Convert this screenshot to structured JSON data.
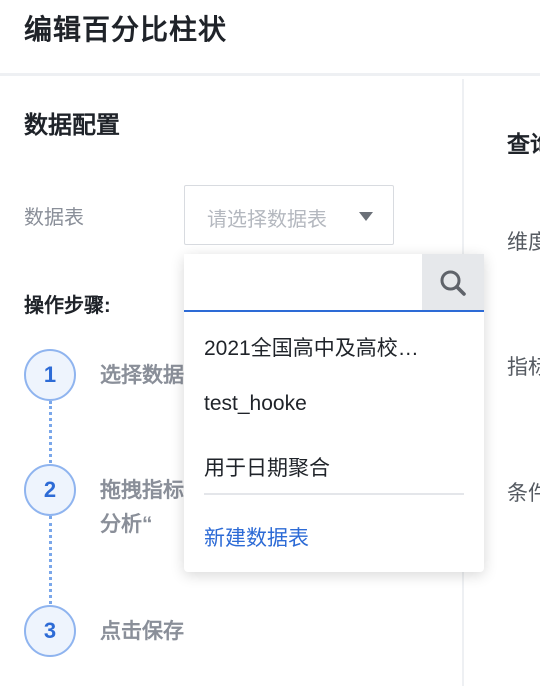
{
  "header": {
    "title": "编辑百分比柱状"
  },
  "config": {
    "title": "数据配置",
    "table_label": "数据表",
    "table_placeholder": "请选择数据表"
  },
  "steps": {
    "title": "操作步骤:",
    "items": [
      {
        "number": "1",
        "text": "选择数据"
      },
      {
        "number": "2",
        "text": "拖拽指标\n分析“"
      },
      {
        "number": "3",
        "text": "点击保存"
      }
    ]
  },
  "right_column": {
    "heading": "查询",
    "labels": [
      "维度",
      "指标",
      "条件"
    ]
  },
  "dropdown": {
    "search_placeholder": "",
    "options": [
      "2021全国高中及高校…",
      "test_hooke",
      "用于日期聚合"
    ],
    "new_table_label": "新建数据表"
  },
  "icons": {
    "search": "search-icon",
    "caret": "caret-down-icon"
  },
  "colors": {
    "accent": "#2d6bd6",
    "muted": "#8a8f99",
    "step_fill": "#eef4fd"
  }
}
